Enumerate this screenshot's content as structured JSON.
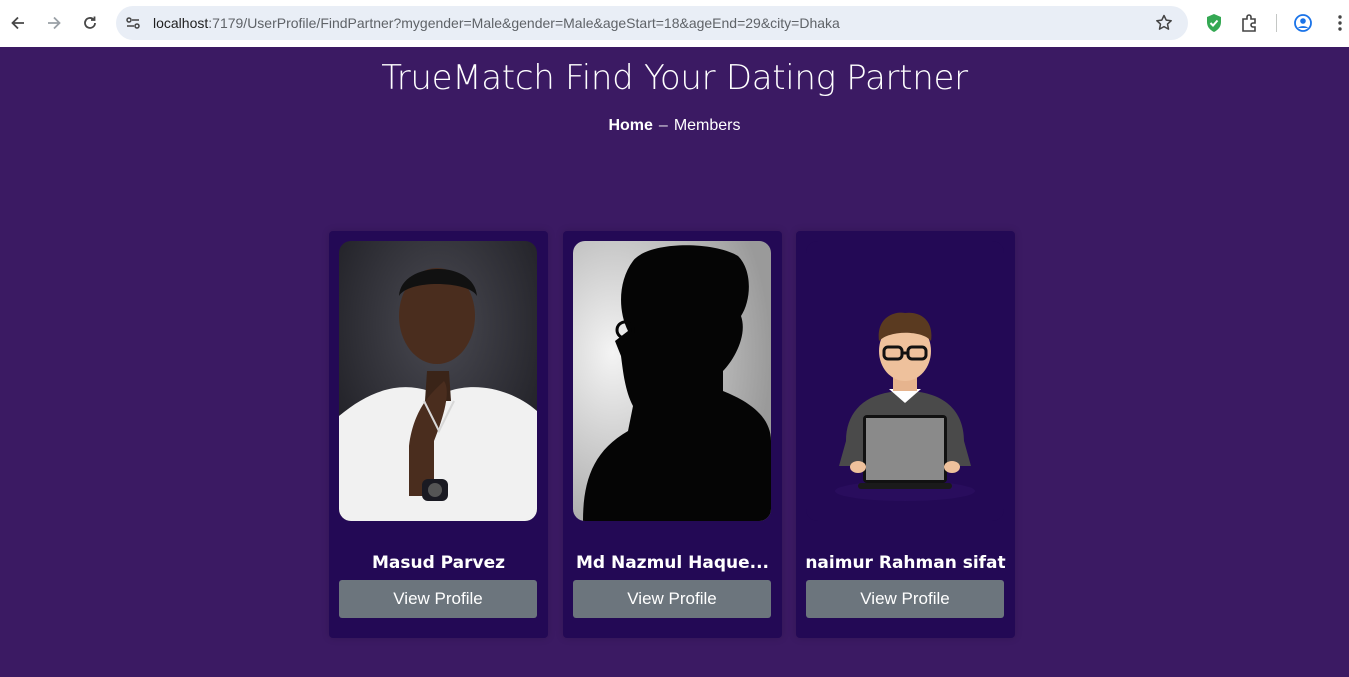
{
  "browser": {
    "url_host": "localhost",
    "url_path": ":7179/UserProfile/FindPartner?mygender=Male&gender=Male&ageStart=18&ageEnd=29&city=Dhaka",
    "icons": [
      "back-icon",
      "forward-icon",
      "reload-icon",
      "site-info-icon",
      "bookmark-star-icon",
      "shield-extension-icon",
      "extensions-puzzle-icon",
      "profile-icon",
      "menu-kebab-icon"
    ]
  },
  "page": {
    "title": "TrueMatch Find Your Dating Partner",
    "breadcrumb": {
      "home": "Home",
      "separator": "–",
      "current": "Members"
    }
  },
  "members": [
    {
      "name": "Masud Parvez",
      "button": "View Profile"
    },
    {
      "name": "Md Nazmul Haque...",
      "button": "View Profile"
    },
    {
      "name": "naimur Rahman sifat",
      "button": "View Profile"
    }
  ],
  "colors": {
    "page_bg": "#3b1a63",
    "card_bg": "#230955",
    "button_bg": "#6c757d"
  }
}
